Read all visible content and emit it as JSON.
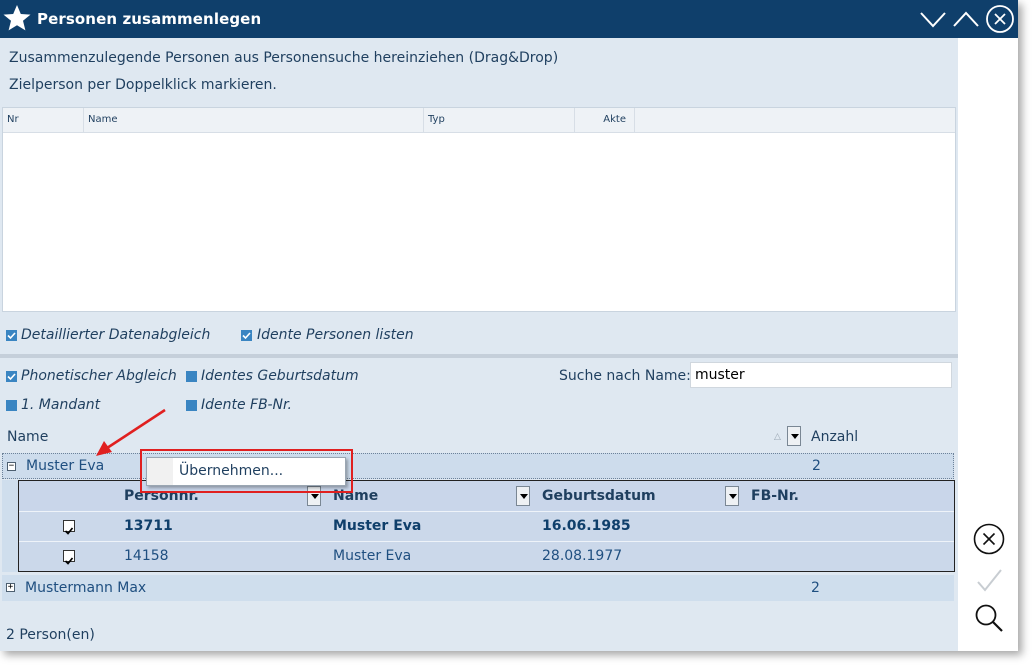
{
  "window": {
    "title": "Personen zusammenlegen"
  },
  "info": {
    "line1": "Zusammenzulegende Personen aus Personensuche hereinziehen (Drag&Drop)",
    "line2": "Zielperson per Doppelklick markieren."
  },
  "drop_grid": {
    "columns": [
      "Nr",
      "Name",
      "Typ",
      "Akte"
    ]
  },
  "options": {
    "detailed_compare": {
      "label": "Detaillierter Datenabgleich",
      "checked": true
    },
    "list_identical": {
      "label": "Idente Personen listen",
      "checked": true
    },
    "phonetic": {
      "label": "Phonetischer Abgleich",
      "checked": true
    },
    "same_birthdate": {
      "label": "Identes Geburtsdatum",
      "checked": false
    },
    "first_client": {
      "label": "1. Mandant",
      "checked": false
    },
    "same_fb": {
      "label": "Idente FB-Nr.",
      "checked": false
    }
  },
  "search": {
    "label": "Suche nach Name:",
    "value": "muster"
  },
  "results": {
    "col_name": "Name",
    "col_count": "Anzahl",
    "groups": [
      {
        "name": "Muster Eva",
        "count": "2",
        "expanded": true
      },
      {
        "name": "Mustermann Max",
        "count": "2",
        "expanded": false
      }
    ],
    "sub_columns": [
      "Personnr.",
      "Name",
      "Geburtsdatum",
      "FB-Nr."
    ],
    "sub_rows": [
      {
        "nr": "13711",
        "name": "Muster Eva",
        "birth": "16.06.1985",
        "fb": "",
        "checked": true,
        "target": true
      },
      {
        "nr": "14158",
        "name": "Muster Eva",
        "birth": "28.08.1977",
        "fb": "",
        "checked": true,
        "target": false
      }
    ]
  },
  "context_menu": {
    "item": "Übernehmen..."
  },
  "status": "2 Person(en)",
  "colors": {
    "titlebar": "#0f3f6b",
    "panel": "#dfe8f1",
    "accent": "#3a85c2",
    "annotation": "#e02020"
  }
}
